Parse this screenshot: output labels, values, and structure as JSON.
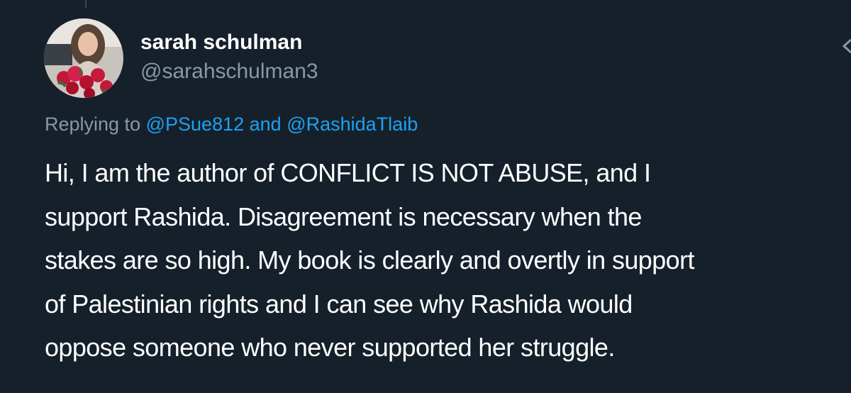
{
  "colors": {
    "background": "#15202b",
    "name_text": "#ffffff",
    "secondary_text": "#8899a6",
    "link": "#1da1f2"
  },
  "author": {
    "display_name": "sarah schulman",
    "handle": "@sarahschulman3",
    "avatar_icon": "profile-photo-with-roses"
  },
  "reply_context": {
    "prefix": "Replying to",
    "mentions": [
      "@PSue812",
      "@RashidaTlaib"
    ],
    "separator": "and"
  },
  "tweet": {
    "lines": [
      "Hi, I am the author of CONFLICT IS NOT ABUSE, and I",
      "support Rashida. Disagreement is necessary when the",
      "stakes are so high. My book is clearly and overtly in support",
      "of Palestinian rights and I can see why Rashida would",
      "oppose someone who never supported her struggle."
    ]
  },
  "icons": {
    "more_menu": "chevron-down-icon"
  }
}
